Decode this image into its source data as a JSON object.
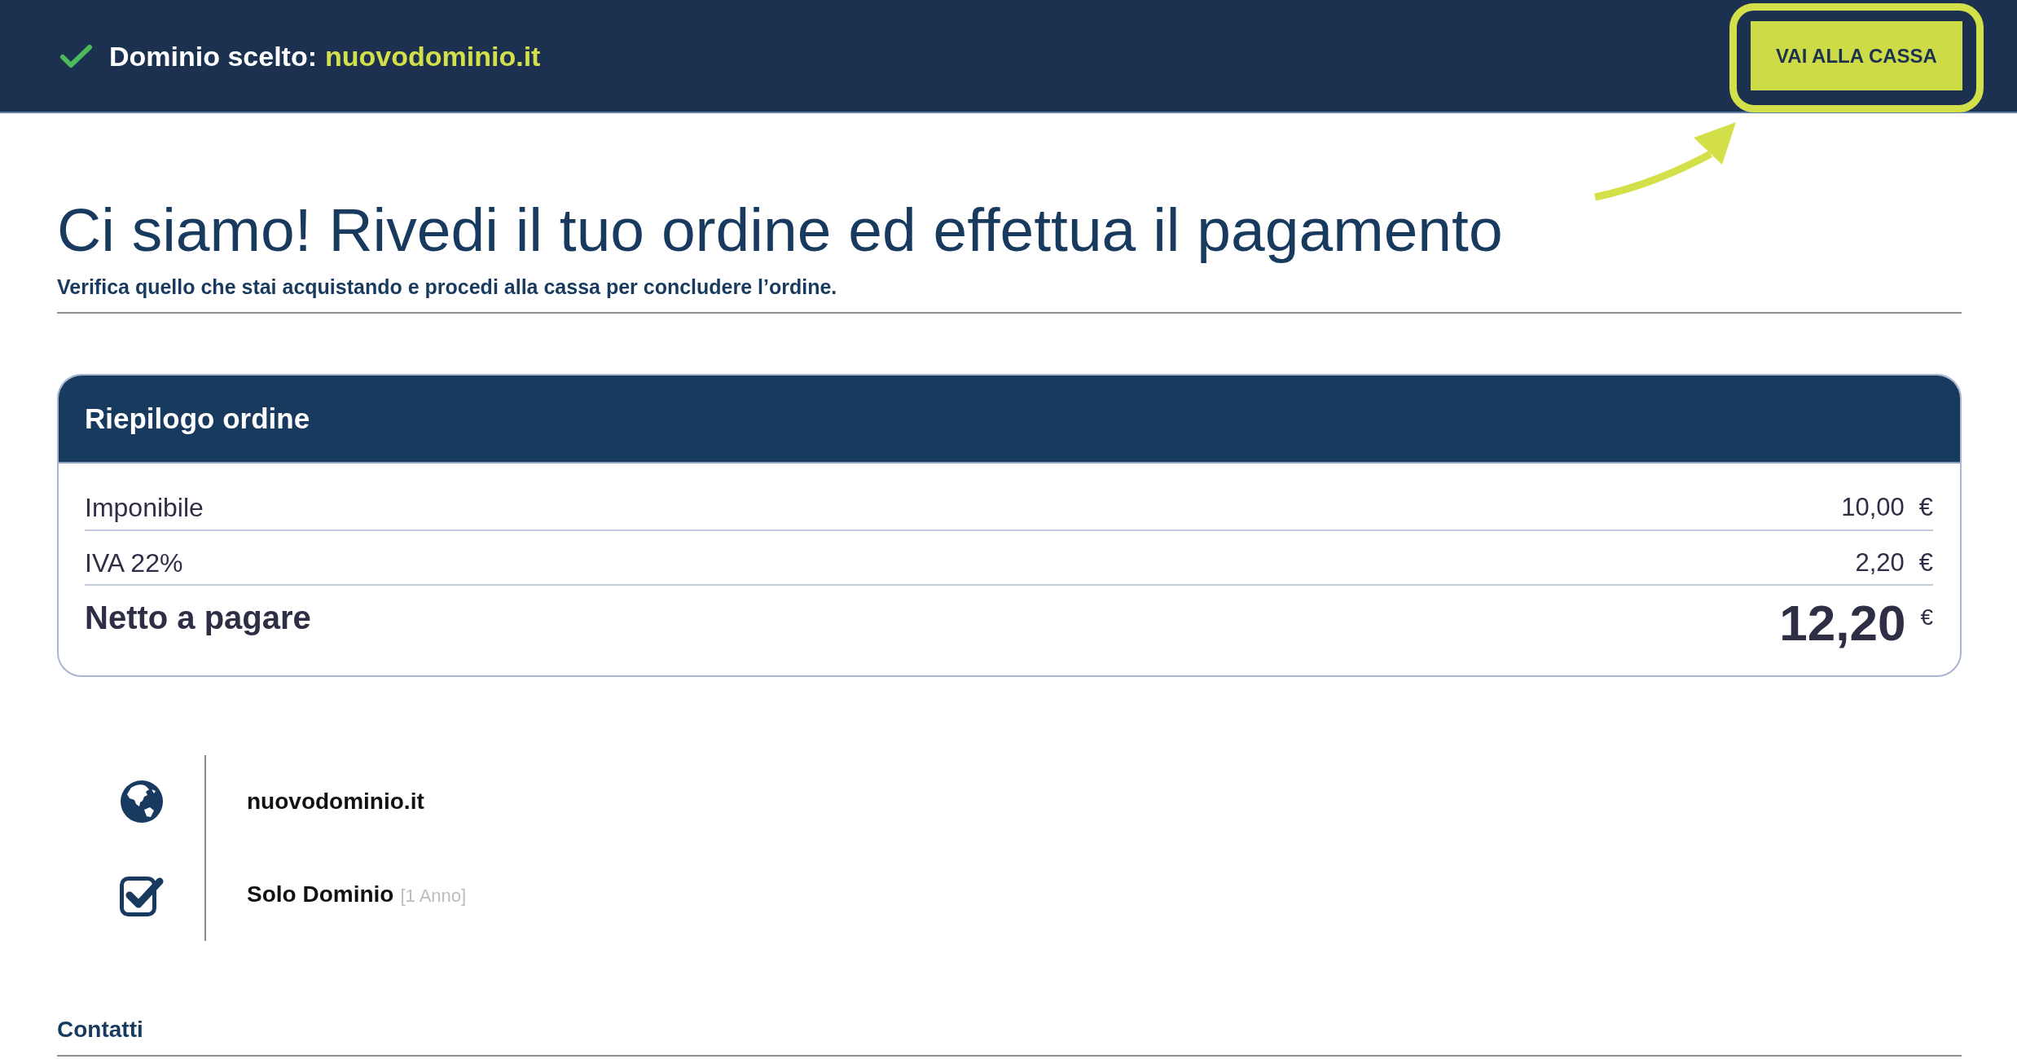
{
  "top_bar": {
    "label": "Dominio scelto:",
    "domain": "nuovodominio.it",
    "checkout_button": {
      "label": "VAI ALLA CASSA",
      "highlighted": true
    }
  },
  "page_header": {
    "title": "Ci siamo! Rivedi il tuo ordine ed effettua il pagamento",
    "subtitle": "Verifica quello che stai acquistando e procedi alla cassa per concludere l’ordine."
  },
  "order_summary": {
    "title": "Riepilogo ordine",
    "rows": [
      {
        "kind": "line",
        "label": "Imponibile",
        "amount": "10,00",
        "currency": "€"
      },
      {
        "kind": "line",
        "label": "IVA 22%",
        "amount": "2,20",
        "currency": "€"
      },
      {
        "kind": "total",
        "label": "Netto a pagare",
        "amount": "12,20",
        "currency": "€"
      }
    ]
  },
  "items": [
    {
      "kind": "domain",
      "name": "nuovodominio.it"
    },
    {
      "kind": "plan",
      "name": "Solo Dominio",
      "term": "[1 Anno]"
    }
  ],
  "contacts": {
    "title": "Contatti"
  }
}
